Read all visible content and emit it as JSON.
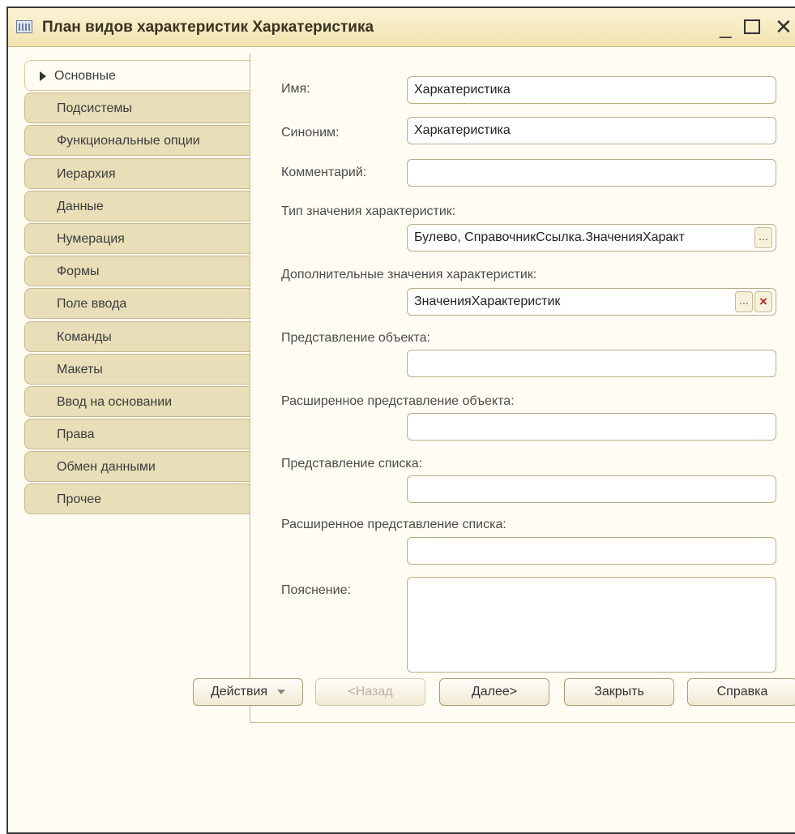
{
  "window": {
    "title": "План видов характеристик Харкатеристика"
  },
  "tabs": [
    {
      "label": "Основные",
      "active": true
    },
    {
      "label": "Подсистемы"
    },
    {
      "label": "Функциональные опции"
    },
    {
      "label": "Иерархия"
    },
    {
      "label": "Данные"
    },
    {
      "label": "Нумерация"
    },
    {
      "label": "Формы"
    },
    {
      "label": "Поле ввода"
    },
    {
      "label": "Команды"
    },
    {
      "label": "Макеты"
    },
    {
      "label": "Ввод на основании"
    },
    {
      "label": "Права"
    },
    {
      "label": "Обмен данными"
    },
    {
      "label": "Прочее"
    }
  ],
  "form": {
    "name_label": "Имя:",
    "name_value": "Харкатеристика",
    "synonym_label": "Синоним:",
    "synonym_value": "Харкатеристика",
    "comment_label": "Комментарий:",
    "comment_value": "",
    "value_type_label": "Тип значения характеристик:",
    "value_type_value": "Булево, СправочникСсылка.ЗначенияХаракт",
    "value_type_button": "...",
    "additional_values_label": "Дополнительные значения характеристик:",
    "additional_values_value": "ЗначенияХарактеристик",
    "additional_values_button": "...",
    "additional_values_clear": "×",
    "object_presentation_label": "Представление объекта:",
    "object_presentation_value": "",
    "extended_object_presentation_label": "Расширенное представление объекта:",
    "extended_object_presentation_value": "",
    "list_presentation_label": "Представление списка:",
    "list_presentation_value": "",
    "extended_list_presentation_label": "Расширенное представление списка:",
    "extended_list_presentation_value": "",
    "explanation_label": "Пояснение:",
    "explanation_value": ""
  },
  "buttons": {
    "actions": "Действия",
    "back": "<Назад",
    "next": "Далее>",
    "close": "Закрыть",
    "help": "Справка"
  },
  "window_controls": {
    "minimize": "_",
    "close": "✕"
  }
}
